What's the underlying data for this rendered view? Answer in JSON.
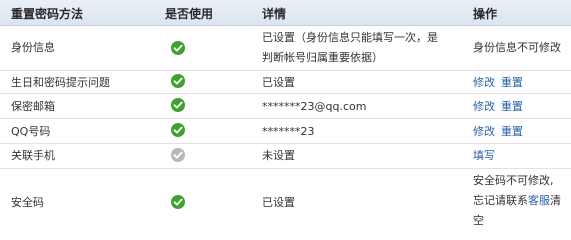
{
  "headers": {
    "method": "重置密码方法",
    "enabled": "是否使用",
    "details": "详情",
    "actions": "操作"
  },
  "rows": [
    {
      "method": "身份信息",
      "enabled_icon": "check-circle-green",
      "details_line1": "已设置（身份信息只能填写一次，是",
      "details_line2": "判断帐号归属重要依据）",
      "action_text": "身份信息不可修改"
    },
    {
      "method": "生日和密码提示问题",
      "enabled_icon": "check-circle-green",
      "details": "已设置",
      "modify": "修改",
      "reset": "重置"
    },
    {
      "method": "保密邮箱",
      "enabled_icon": "check-circle-green",
      "details": "*******23@qq.com",
      "modify": "修改",
      "reset": "重置"
    },
    {
      "method": "QQ号码",
      "enabled_icon": "check-circle-green",
      "details": "*******23",
      "modify": "修改",
      "reset": "重置"
    },
    {
      "method": "关联手机",
      "enabled_icon": "check-circle-gray",
      "details": "未设置",
      "fill": "填写"
    },
    {
      "method": "安全码",
      "enabled_icon": "check-circle-green",
      "details": "已设置",
      "action_line1": "安全码不可修改,",
      "action_line2_pre": "忘记请联系",
      "action_line2_link": "客服",
      "action_line2_post": "清",
      "action_line3": "空"
    }
  ],
  "colors": {
    "check_enabled": "#3fa12f",
    "check_disabled": "#b8b8b8",
    "link": "#2a5fa8",
    "header_bg": "#e3ebf4"
  }
}
